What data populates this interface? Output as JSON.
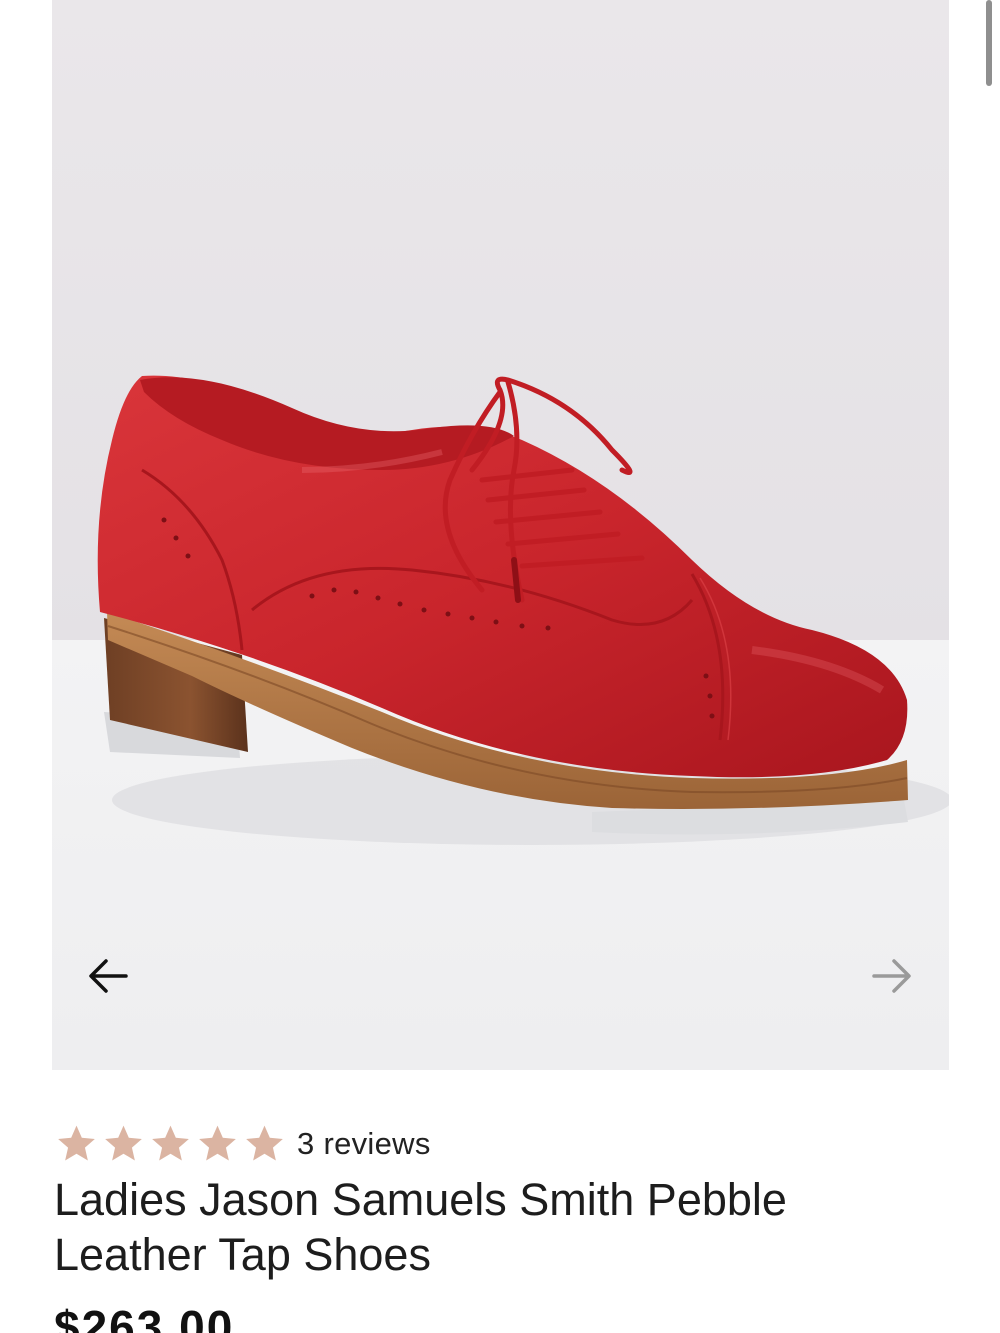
{
  "product": {
    "image": {
      "subject": "red-leather-tap-shoe",
      "prev_icon": "arrow-left-icon",
      "next_icon": "arrow-right-icon"
    },
    "rating": {
      "stars": 5,
      "max_stars": 5,
      "star_color": "#dbb4a2",
      "reviews_label": "3 reviews"
    },
    "title": "Ladies Jason Samuels Smith Pebble Leather Tap Shoes",
    "price": "$263.00"
  },
  "colors": {
    "backdrop": "#e8e5e8",
    "floor": "#f1f1f2",
    "shoe_red": "#c8242b",
    "sole_wood": "#a46a3e"
  }
}
